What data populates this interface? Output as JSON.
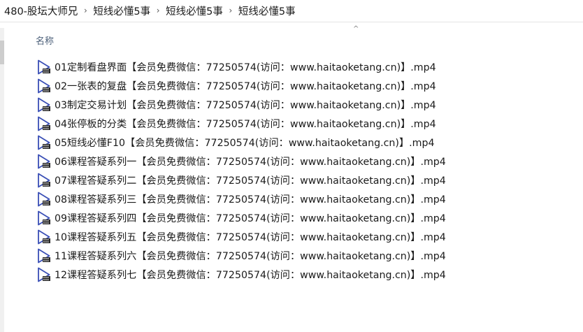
{
  "breadcrumb": {
    "items": [
      "480-股坛大师兄",
      "短线必懂5事",
      "短线必懂5事",
      "短线必懂5事"
    ],
    "separator": "›"
  },
  "column_header": {
    "name_label": "名称",
    "sort_indicator": "^"
  },
  "files": [
    {
      "name": "01定制看盘界面【会员免费微信：77250574(访问：www.haitaoketang.cn)】.mp4",
      "icon": "video-file-icon"
    },
    {
      "name": "02一张表的复盘【会员免费微信：77250574(访问：www.haitaoketang.cn)】.mp4",
      "icon": "video-file-icon"
    },
    {
      "name": "03制定交易计划【会员免费微信：77250574(访问：www.haitaoketang.cn)】.mp4",
      "icon": "video-file-icon"
    },
    {
      "name": "04张停板的分类【会员免费微信：77250574(访问：www.haitaoketang.cn)】.mp4",
      "icon": "video-file-icon"
    },
    {
      "name": "05短线必懂F10【会员免费微信：77250574(访问：www.haitaoketang.cn)】.mp4",
      "icon": "video-file-icon"
    },
    {
      "name": "06课程答疑系列一【会员免费微信：77250574(访问：www.haitaoketang.cn)】.mp4",
      "icon": "video-file-icon"
    },
    {
      "name": "07课程答疑系列二【会员免费微信：77250574(访问：www.haitaoketang.cn)】.mp4",
      "icon": "video-file-icon"
    },
    {
      "name": "08课程答疑系列三【会员免费微信：77250574(访问：www.haitaoketang.cn)】.mp4",
      "icon": "video-file-icon"
    },
    {
      "name": "09课程答疑系列四【会员免费微信：77250574(访问：www.haitaoketang.cn)】.mp4",
      "icon": "video-file-icon"
    },
    {
      "name": "10课程答疑系列五【会员免费微信：77250574(访问：www.haitaoketang.cn)】.mp4",
      "icon": "video-file-icon"
    },
    {
      "name": "11课程答疑系列六【会员免费微信：77250574(访问：www.haitaoketang.cn)】.mp4",
      "icon": "video-file-icon"
    },
    {
      "name": "12课程答疑系列七【会员免费微信：77250574(访问：www.haitaoketang.cn)】.mp4",
      "icon": "video-file-icon"
    }
  ],
  "colors": {
    "icon_play": "#3a4fb6",
    "icon_strip": "#2b2b2b",
    "header_text": "#4c607a"
  }
}
